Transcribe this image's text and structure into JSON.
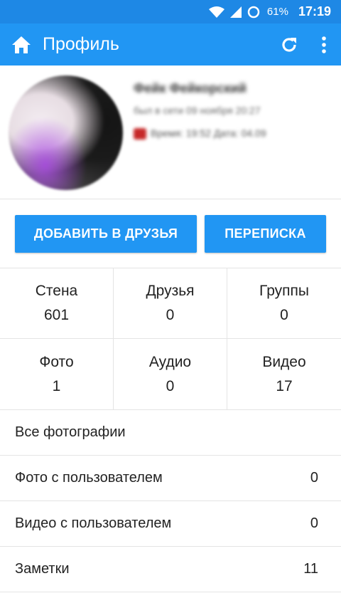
{
  "status_bar": {
    "battery_percent": "61%",
    "time": "17:19"
  },
  "app_bar": {
    "title": "Профиль",
    "icons": [
      "home-icon",
      "refresh-icon",
      "more-vert-icon"
    ]
  },
  "profile": {
    "name": "Фейк Фейкорский",
    "status": "был в сети 09 ноября 20:27",
    "meta_line": "Время: 19:52   Дата: 04.09"
  },
  "actions": {
    "add_friend_label": "ДОБАВИТЬ В ДРУЗЬЯ",
    "messages_label": "ПЕРЕПИСКА"
  },
  "counters": [
    {
      "label": "Стена",
      "value": "601"
    },
    {
      "label": "Друзья",
      "value": "0"
    },
    {
      "label": "Группы",
      "value": "0"
    },
    {
      "label": "Фото",
      "value": "1"
    },
    {
      "label": "Аудио",
      "value": "0"
    },
    {
      "label": "Видео",
      "value": "17"
    }
  ],
  "list": [
    {
      "label": "Все фотографии",
      "count": ""
    },
    {
      "label": "Фото с пользователем",
      "count": "0"
    },
    {
      "label": "Видео с пользователем",
      "count": "0"
    },
    {
      "label": "Заметки",
      "count": "11"
    }
  ],
  "colors": {
    "app_bar": "#2196f3",
    "status_bar": "#1e88e5",
    "button": "#2196f3",
    "divider": "#e4e4e4"
  }
}
